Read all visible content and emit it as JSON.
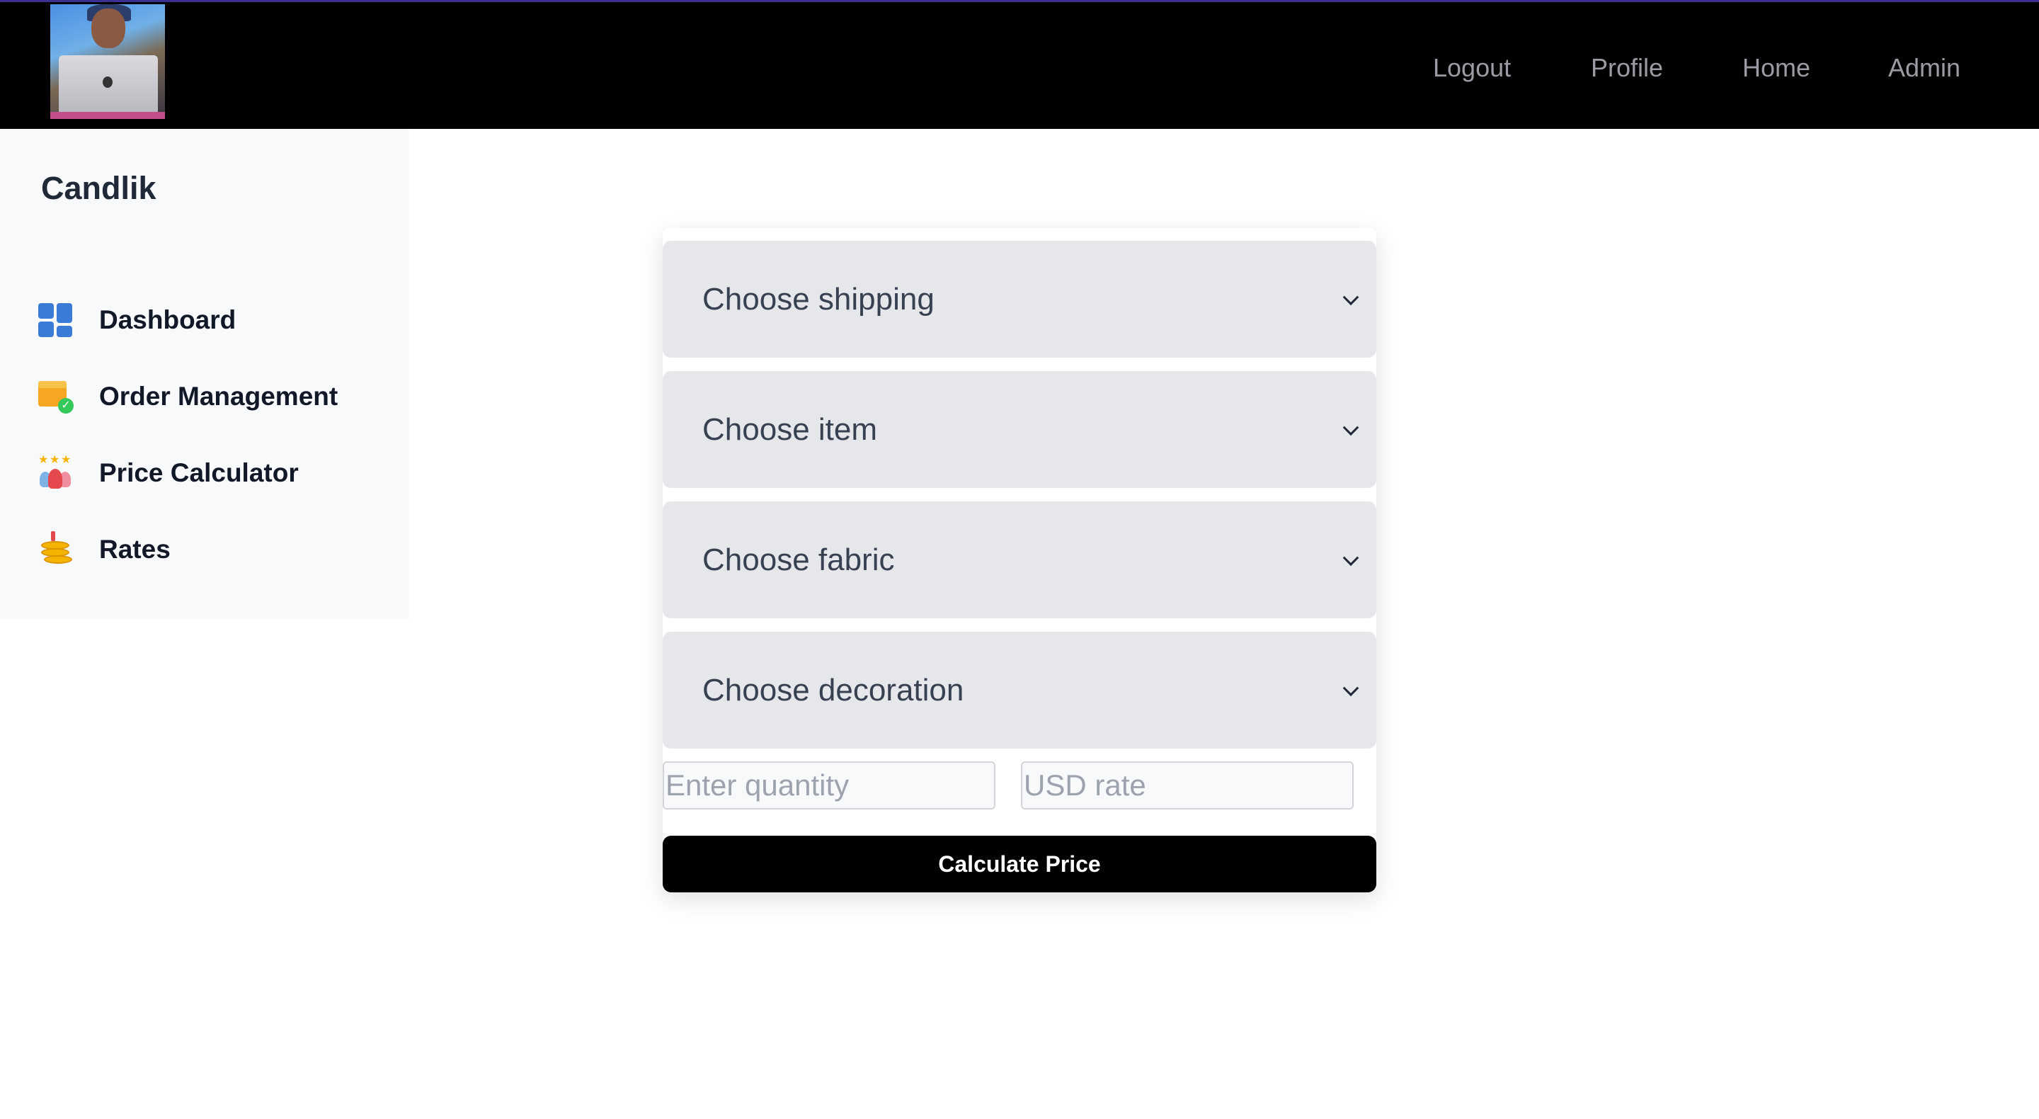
{
  "header": {
    "nav": {
      "logout": "Logout",
      "profile": "Profile",
      "home": "Home",
      "admin": "Admin"
    }
  },
  "sidebar": {
    "brand": "Candlik",
    "items": [
      {
        "label": "Dashboard",
        "icon": "dashboard-icon"
      },
      {
        "label": "Order Management",
        "icon": "package-check-icon"
      },
      {
        "label": "Price Calculator",
        "icon": "people-stars-icon"
      },
      {
        "label": "Rates",
        "icon": "coins-icon"
      }
    ]
  },
  "form": {
    "selects": {
      "shipping": "Choose shipping",
      "item": "Choose item",
      "fabric": "Choose fabric",
      "decoration": "Choose decoration"
    },
    "quantity_placeholder": "Enter quantity",
    "usd_rate_placeholder": "USD rate",
    "submit_label": "Calculate Price"
  },
  "colors": {
    "topbar": "#000000",
    "sidebar_bg": "#f8f9fb",
    "select_bg": "#e5e7eb",
    "button_bg": "#000000",
    "nav_text": "#9b9ca3",
    "accent_border": "#3b2f8f"
  }
}
